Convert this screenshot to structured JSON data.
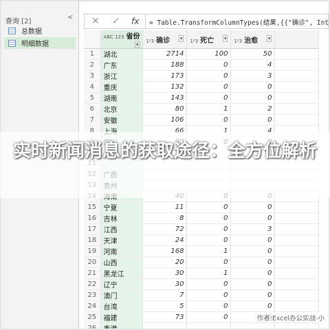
{
  "queries": {
    "header": "查询 [2]",
    "collapse": "<",
    "items": [
      {
        "label": "总数据",
        "selected": false
      },
      {
        "label": "明细数据",
        "selected": true
      }
    ]
  },
  "formula_bar": {
    "cancel": "✕",
    "confirm": "✓",
    "fx": "fx",
    "formula": "= Table.TransformColumnTypes(结果,{{\"确诊\", Int64.Ty"
  },
  "columns": [
    {
      "type": "ABC\n123",
      "name": "省份"
    },
    {
      "type": "1²3",
      "name": "确诊"
    },
    {
      "type": "1²3",
      "name": "死亡"
    },
    {
      "type": "1²3",
      "name": "治愈"
    }
  ],
  "rows": [
    [
      "1",
      "湖北",
      "2714",
      "100",
      "50"
    ],
    [
      "2",
      "广东",
      "188",
      "0",
      "4"
    ],
    [
      "3",
      "浙江",
      "173",
      "0",
      "3"
    ],
    [
      "4",
      "重庆",
      "132",
      "0",
      "0"
    ],
    [
      "5",
      "湖南",
      "143",
      "0",
      "0"
    ],
    [
      "6",
      "北京",
      "80",
      "1",
      "2"
    ],
    [
      "7",
      "安徽",
      "106",
      "0",
      "0"
    ],
    [
      "8",
      "上海",
      "66",
      "1",
      "4"
    ],
    [
      "9",
      "四川",
      "90",
      "0",
      "0"
    ],
    [
      "10",
      "",
      "",
      "",
      ""
    ],
    [
      "11",
      "",
      "",
      "",
      ""
    ],
    [
      "12",
      "广西",
      "",
      "",
      ""
    ],
    [
      "13",
      "贵州",
      "",
      "",
      ""
    ],
    [
      "14",
      "海南",
      "40",
      "0",
      "0"
    ],
    [
      "15",
      "宁夏",
      "11",
      "0",
      "0"
    ],
    [
      "16",
      "吉林",
      "8",
      "0",
      "0"
    ],
    [
      "17",
      "江西",
      "72",
      "0",
      "3"
    ],
    [
      "18",
      "天津",
      "24",
      "0",
      "0"
    ],
    [
      "19",
      "河南",
      "168",
      "1",
      "0"
    ],
    [
      "20",
      "山西",
      "20",
      "0",
      "0"
    ],
    [
      "21",
      "黑龙江",
      "30",
      "1",
      "0"
    ],
    [
      "22",
      "辽宁",
      "30",
      "0",
      "0"
    ],
    [
      "23",
      "澳门",
      "7",
      "0",
      "0"
    ],
    [
      "24",
      "台湾",
      "5",
      "0",
      "0"
    ],
    [
      "25",
      "福建",
      "73",
      "0",
      "0"
    ],
    [
      "26",
      "香港",
      "",
      "",
      ""
    ]
  ],
  "overlay_title": "实时新闻消息的获取途径：全方位解析",
  "watermark": "作者:Excel办公实战-小"
}
